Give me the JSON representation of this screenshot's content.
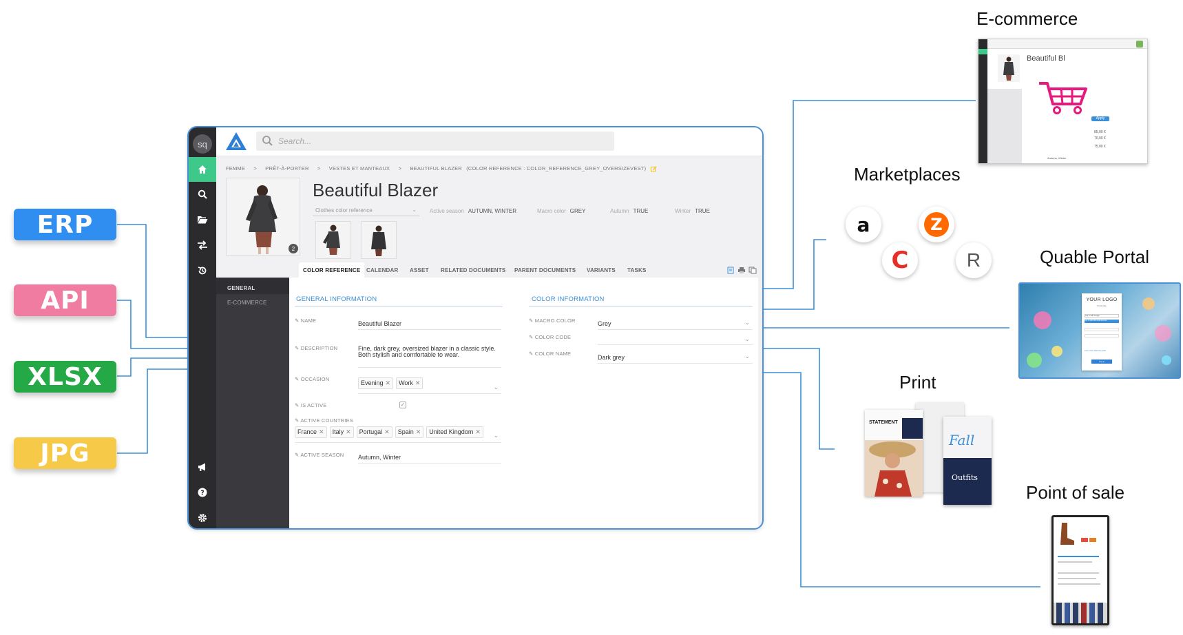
{
  "sources": [
    {
      "label": "ERP",
      "color": "#2f8ef0"
    },
    {
      "label": "API",
      "color": "#f07ca2"
    },
    {
      "label": "XLSX",
      "color": "#25a846"
    },
    {
      "label": "JPG",
      "color": "#f7c948"
    }
  ],
  "app": {
    "avatar": "sq",
    "search_placeholder": "Search...",
    "breadcrumbs": [
      "FEMME",
      ">",
      "PRÊT-À-PORTER",
      ">",
      "VESTES ET MANTEAUX",
      ">",
      "BEAUTIFUL BLAZER",
      "(COLOR REFERENCE : COLOR_REFERENCE_GREY_OVERSIZEVEST)"
    ],
    "image_count": "2",
    "title": "Beautiful Blazer",
    "family_select": "Clothes color reference",
    "meta": [
      {
        "label": "Active season",
        "value": "AUTUMN, WINTER"
      },
      {
        "label": "Macro color",
        "value": "GREY"
      },
      {
        "label": "Autumn",
        "value": "TRUE"
      },
      {
        "label": "Winter",
        "value": "TRUE"
      }
    ],
    "tabs": [
      "COLOR REFERENCE",
      "CALENDAR",
      "ASSET",
      "RELATED DOCUMENTS",
      "PARENT DOCUMENTS",
      "VARIANTS",
      "TASKS"
    ],
    "nav": [
      "GENERAL",
      "E-COMMERCE"
    ],
    "general": {
      "title": "GENERAL INFORMATION",
      "name_label": "NAME",
      "name_value": "Beautiful Blazer",
      "description_label": "DESCRIPTION",
      "description_value": "Fine, dark grey, oversized blazer in a classic style. Both stylish and comfortable to wear.",
      "occasion_label": "OCCASION",
      "occasions": [
        "Evening",
        "Work"
      ],
      "is_active_label": "IS ACTIVE",
      "countries_label": "ACTIVE COUNTRIES",
      "countries": [
        "France",
        "Italy",
        "Portugal",
        "Spain",
        "United Kingdom"
      ],
      "season_label": "ACTIVE SEASON",
      "season_value": "Autumn, Winter"
    },
    "color": {
      "title": "COLOR INFORMATION",
      "macro_label": "MACRO COLOR",
      "macro_value": "Grey",
      "code_label": "COLOR CODE",
      "code_value": "",
      "name_label": "COLOR NAME",
      "name_value": "Dark grey"
    }
  },
  "outputs": {
    "ecommerce": {
      "label": "E-commerce",
      "screen_title": "Beautiful Bl",
      "apply": "Apply",
      "prices": [
        "85,00 €",
        "70,00 €",
        "75,00 €"
      ],
      "note": "Autumn, Winter"
    },
    "marketplaces": {
      "label": "Marketplaces",
      "logos": [
        "a",
        "Z",
        "C",
        "R"
      ]
    },
    "portal": {
      "label": "Quable Portal",
      "logo": "YOUR LOGO",
      "subtitle": "Portal title",
      "google": "Log in with Google",
      "microsoft": "Log in with Microsoft Account",
      "link": "Learn more about the portal",
      "button": "Log in"
    },
    "print": {
      "label": "Print",
      "statement": "STATEMENT",
      "fall": "Fall",
      "outfits": "Outfits"
    },
    "pos": {
      "label": "Point of sale"
    }
  },
  "colors": {
    "accent": "#3a8fd8",
    "active_nav": "#3ec98a",
    "cart": "#e6197f",
    "line": "#3a8fd8"
  }
}
